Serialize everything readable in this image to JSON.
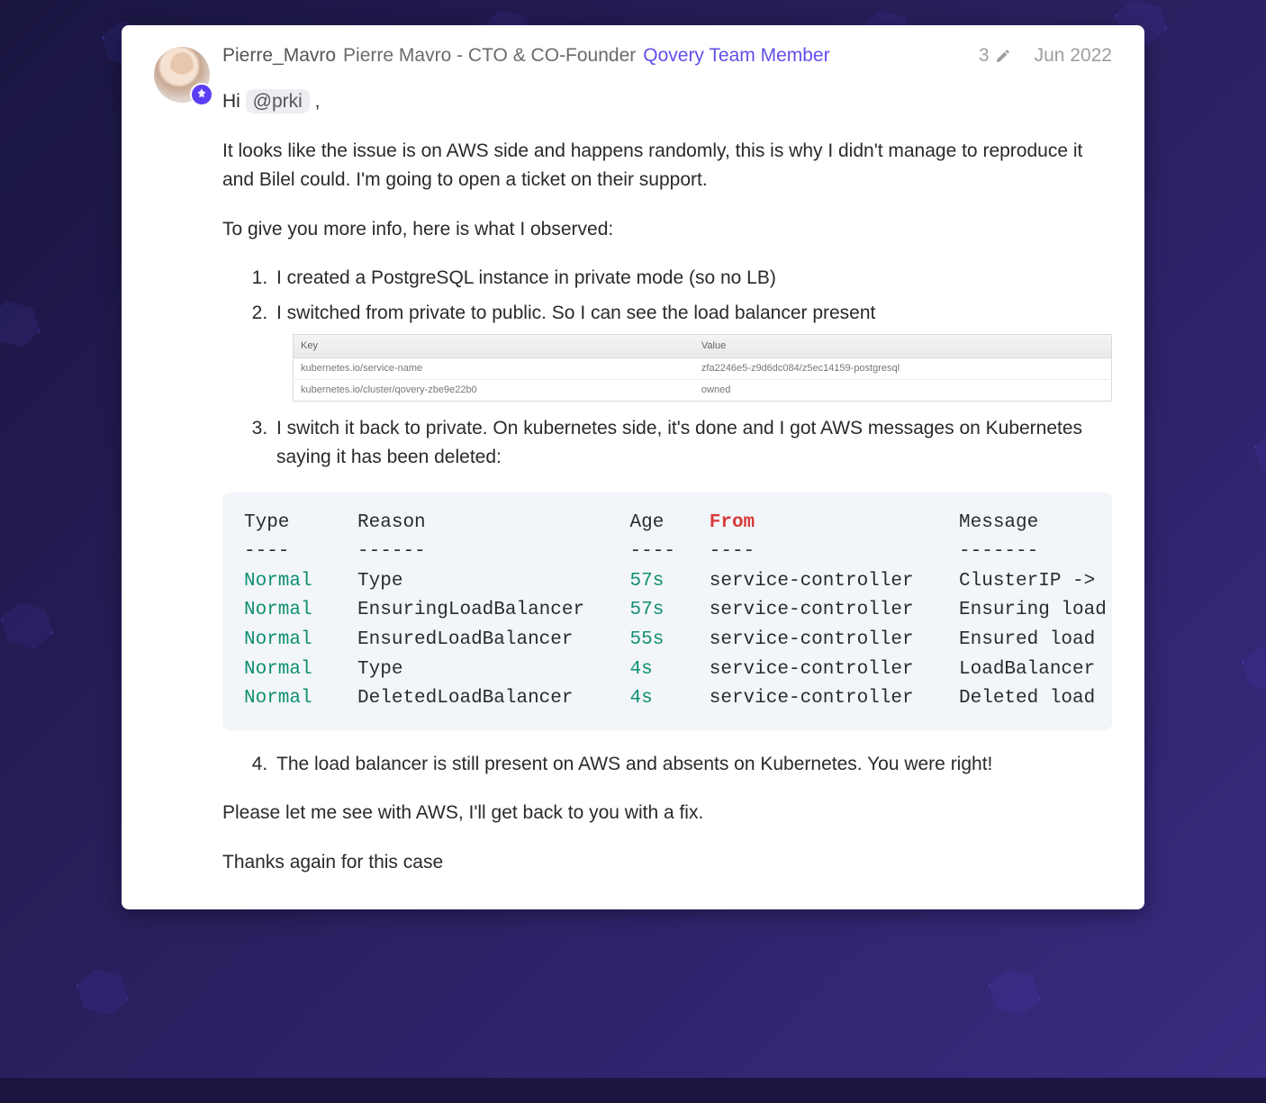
{
  "post": {
    "author": {
      "username": "Pierre_Mavro",
      "fullname_title": "Pierre Mavro - CTO & CO-Founder",
      "team_label": "Qovery Team Member"
    },
    "edits": "3",
    "date": "Jun 2022",
    "greeting_prefix": "Hi ",
    "greeting_mention": "@prki",
    "greeting_suffix": " ,",
    "para1": "It looks like the issue is on AWS side and happens randomly, this is why I didn't manage to reproduce it and Bilel could. I'm going to open a ticket on their support.",
    "para2": "To give you more info, here is what I observed:",
    "list": {
      "item1": "I created a PostgreSQL instance in private mode (so no LB)",
      "item2": "I switched from private to public. So I can see the load balancer present",
      "item3": "I switch it back to private. On kubernetes side, it's done and I got AWS messages on Kubernetes saying it has been deleted:",
      "item4": "The load balancer is still present on AWS and absents on Kubernetes. You were right!"
    },
    "kv_table": {
      "headers": {
        "key": "Key",
        "value": "Value"
      },
      "rows": [
        {
          "key": "kubernetes.io/service-name",
          "value": "zfa2246e5-z9d6dc084/z5ec14159-postgresql"
        },
        {
          "key": "kubernetes.io/cluster/qovery-zbe9e22b0",
          "value": "owned"
        }
      ]
    },
    "code": {
      "headers": {
        "type": "Type",
        "reason": "Reason",
        "age": "Age",
        "from": "From",
        "message": "Message"
      },
      "dashes": {
        "type": "----",
        "reason": "------",
        "age": "----",
        "from": "----",
        "message": "-------"
      },
      "rows": [
        {
          "type": "Normal",
          "reason": "Type",
          "age": "57s",
          "from": "service-controller",
          "message": "ClusterIP ->"
        },
        {
          "type": "Normal",
          "reason": "EnsuringLoadBalancer",
          "age": "57s",
          "from": "service-controller",
          "message": "Ensuring load"
        },
        {
          "type": "Normal",
          "reason": "EnsuredLoadBalancer",
          "age": "55s",
          "from": "service-controller",
          "message": "Ensured load"
        },
        {
          "type": "Normal",
          "reason": "Type",
          "age": "4s",
          "from": "service-controller",
          "message": "LoadBalancer"
        },
        {
          "type": "Normal",
          "reason": "DeletedLoadBalancer",
          "age": "4s",
          "from": "service-controller",
          "message": "Deleted load"
        }
      ]
    },
    "para3": "Please let me see with AWS, I'll get back to you with a fix.",
    "para4": "Thanks again for this case"
  },
  "colors": {
    "accent": "#5b3df5"
  }
}
